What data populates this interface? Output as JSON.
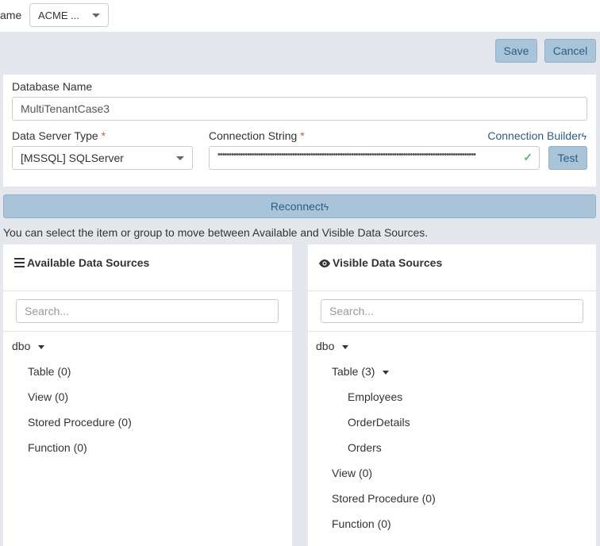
{
  "topbar": {
    "name_label": "ame",
    "tenant_value": "ACME ..."
  },
  "toolbar": {
    "save_label": "Save",
    "cancel_label": "Cancel"
  },
  "form": {
    "database_name_label": "Database Name",
    "database_name_value": "MultiTenantCase3",
    "server_type_label": "Data Server Type",
    "server_type_value": "[MSSQL] SQLServer",
    "connection_string_label": "Connection String",
    "connection_string_value": "••••••••••••••••••••••••••••••••••••••••••••••••••••••••••••••••••••••••••••••••••••••••••••••••••••••••••••••••••",
    "required_mark": "*",
    "connection_builder_label": "Connection Builder",
    "bolt_glyph": "ϟ",
    "test_label": "Test"
  },
  "reconnect_label": "Reconnect",
  "hint_text": "You can select the item or group to move between Available and Visible Data Sources.",
  "available": {
    "title": "Available Data Sources",
    "search_placeholder": "Search...",
    "schema": "dbo",
    "items": [
      "Table (0)",
      "View (0)",
      "Stored Procedure (0)",
      "Function (0)"
    ]
  },
  "visible": {
    "title": "Visible Data Sources",
    "search_placeholder": "Search...",
    "schema": "dbo",
    "table_group": "Table (3)",
    "tables": [
      "Employees",
      "OrderDetails",
      "Orders"
    ],
    "items": [
      "View (0)",
      "Stored Procedure (0)",
      "Function (0)"
    ]
  },
  "colors": {
    "accent_button": "#a9c4d8",
    "accent_text": "#2c5d87",
    "required": "#d9534f",
    "success": "#5cb85c"
  }
}
